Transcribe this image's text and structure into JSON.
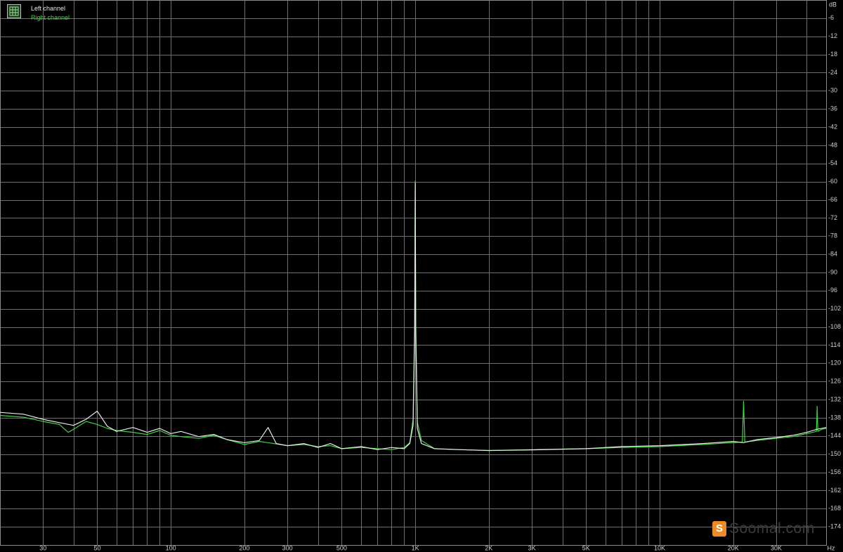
{
  "chart_data": {
    "type": "line",
    "title": "",
    "xlabel": "",
    "ylabel": "",
    "x_unit": "Hz",
    "y_unit": "dB",
    "x_scale": "log",
    "xlim": [
      20,
      48000
    ],
    "ylim": [
      -180,
      0
    ],
    "grid": true,
    "background": "#000000",
    "grid_color": "#6e6e6e",
    "legend_position": "top-left",
    "x_tick_labels": [
      {
        "value": 30,
        "label": "30"
      },
      {
        "value": 50,
        "label": "50"
      },
      {
        "value": 100,
        "label": "100"
      },
      {
        "value": 200,
        "label": "200"
      },
      {
        "value": 300,
        "label": "300"
      },
      {
        "value": 500,
        "label": "500"
      },
      {
        "value": 1000,
        "label": "1K"
      },
      {
        "value": 2000,
        "label": "2K"
      },
      {
        "value": 3000,
        "label": "3K"
      },
      {
        "value": 5000,
        "label": "5K"
      },
      {
        "value": 10000,
        "label": "10K"
      },
      {
        "value": 20000,
        "label": "20K"
      },
      {
        "value": 30000,
        "label": "30K"
      }
    ],
    "x_minor_ticks": [
      20,
      40,
      60,
      70,
      80,
      90,
      400,
      600,
      700,
      800,
      900,
      4000,
      6000,
      7000,
      8000,
      9000,
      40000
    ],
    "y_ticks": [
      -6,
      -12,
      -18,
      -24,
      -30,
      -36,
      -42,
      -48,
      -54,
      -60,
      -66,
      -72,
      -78,
      -84,
      -90,
      -96,
      -102,
      -108,
      -114,
      -120,
      -126,
      -132,
      -138,
      -144,
      -150,
      -156,
      -162,
      -168,
      -174
    ],
    "series": [
      {
        "name": "Left channel",
        "color": "#e8e8e8",
        "points": [
          [
            20,
            -136.2
          ],
          [
            25,
            -136.8
          ],
          [
            30,
            -138.5
          ],
          [
            35,
            -139.6
          ],
          [
            40,
            -140.5
          ],
          [
            45,
            -138.5
          ],
          [
            50,
            -135.8
          ],
          [
            55,
            -140.8
          ],
          [
            60,
            -142.5
          ],
          [
            70,
            -141.2
          ],
          [
            80,
            -142.8
          ],
          [
            90,
            -141.5
          ],
          [
            100,
            -143.2
          ],
          [
            110,
            -142.5
          ],
          [
            130,
            -144.2
          ],
          [
            150,
            -143.5
          ],
          [
            170,
            -145.2
          ],
          [
            200,
            -146.2
          ],
          [
            230,
            -145.5
          ],
          [
            250,
            -141.2
          ],
          [
            270,
            -146.5
          ],
          [
            300,
            -147.2
          ],
          [
            350,
            -146.5
          ],
          [
            400,
            -147.8
          ],
          [
            450,
            -146.5
          ],
          [
            500,
            -148.2
          ],
          [
            600,
            -147.5
          ],
          [
            700,
            -148.5
          ],
          [
            800,
            -147.8
          ],
          [
            900,
            -148.2
          ],
          [
            950,
            -146.5
          ],
          [
            980,
            -140.5
          ],
          [
            995,
            -110.5
          ],
          [
            1000,
            -60.5
          ],
          [
            1005,
            -110.5
          ],
          [
            1020,
            -141.5
          ],
          [
            1060,
            -146.5
          ],
          [
            1200,
            -148.2
          ],
          [
            1500,
            -148.5
          ],
          [
            2000,
            -148.8
          ],
          [
            3000,
            -148.6
          ],
          [
            5000,
            -148.2
          ],
          [
            7000,
            -147.5
          ],
          [
            10000,
            -147.2
          ],
          [
            15000,
            -146.5
          ],
          [
            20000,
            -145.8
          ],
          [
            22000,
            -146.2
          ],
          [
            25000,
            -145.2
          ],
          [
            30000,
            -144.5
          ],
          [
            35000,
            -143.8
          ],
          [
            40000,
            -142.8
          ],
          [
            44000,
            -141.8
          ],
          [
            48000,
            -141.2
          ]
        ]
      },
      {
        "name": "Right channel",
        "color": "#3dd43d",
        "points": [
          [
            20,
            -137.2
          ],
          [
            25,
            -137.8
          ],
          [
            30,
            -139.2
          ],
          [
            35,
            -140.2
          ],
          [
            38,
            -142.8
          ],
          [
            40,
            -141.8
          ],
          [
            45,
            -139.2
          ],
          [
            48,
            -139.8
          ],
          [
            50,
            -140.2
          ],
          [
            55,
            -141.5
          ],
          [
            60,
            -142.2
          ],
          [
            70,
            -142.8
          ],
          [
            80,
            -143.5
          ],
          [
            90,
            -142.2
          ],
          [
            100,
            -143.8
          ],
          [
            110,
            -144.2
          ],
          [
            130,
            -144.8
          ],
          [
            150,
            -143.8
          ],
          [
            170,
            -145.2
          ],
          [
            200,
            -146.8
          ],
          [
            230,
            -145.8
          ],
          [
            250,
            -146.2
          ],
          [
            300,
            -147.2
          ],
          [
            350,
            -146.8
          ],
          [
            400,
            -147.5
          ],
          [
            450,
            -147.2
          ],
          [
            500,
            -148.2
          ],
          [
            600,
            -147.8
          ],
          [
            700,
            -148.2
          ],
          [
            800,
            -148.5
          ],
          [
            900,
            -147.8
          ],
          [
            950,
            -146.2
          ],
          [
            980,
            -138.5
          ],
          [
            995,
            -105.5
          ],
          [
            1000,
            -59.8
          ],
          [
            1005,
            -105.5
          ],
          [
            1020,
            -139.5
          ],
          [
            1060,
            -145.5
          ],
          [
            1200,
            -148.2
          ],
          [
            1500,
            -148.5
          ],
          [
            2000,
            -148.8
          ],
          [
            3000,
            -148.5
          ],
          [
            5000,
            -148.2
          ],
          [
            7000,
            -147.8
          ],
          [
            10000,
            -147.5
          ],
          [
            15000,
            -146.8
          ],
          [
            20000,
            -146.2
          ],
          [
            21800,
            -146.0
          ],
          [
            22050,
            -132.5
          ],
          [
            22300,
            -146.0
          ],
          [
            25000,
            -145.5
          ],
          [
            30000,
            -144.8
          ],
          [
            35000,
            -144.2
          ],
          [
            40000,
            -143.2
          ],
          [
            43800,
            -142.5
          ],
          [
            44100,
            -134.2
          ],
          [
            44400,
            -142.5
          ],
          [
            46000,
            -141.8
          ],
          [
            48000,
            -141.5
          ]
        ]
      }
    ]
  },
  "watermark": {
    "logo_glyph": "S",
    "text": "Soomal.com",
    "logo_color": "#f08a24"
  },
  "legend_icon": "spectrum-grid-icon"
}
